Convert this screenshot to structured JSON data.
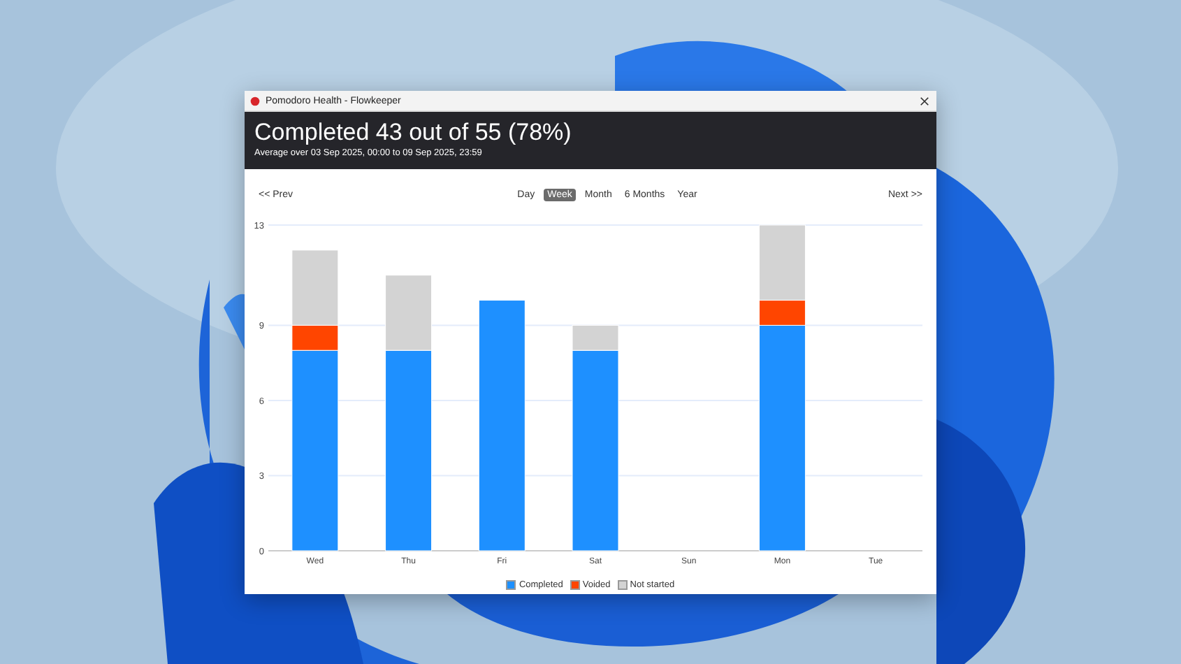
{
  "window": {
    "title": "Pomodoro Health - Flowkeeper"
  },
  "header": {
    "title": "Completed 43 out of 55 (78%)",
    "subtitle": "Average over 03 Sep 2025, 00:00 to 09 Sep 2025, 23:59"
  },
  "nav": {
    "prev": "<< Prev",
    "next": "Next >>",
    "periods": [
      {
        "label": "Day",
        "selected": false
      },
      {
        "label": "Week",
        "selected": true
      },
      {
        "label": "Month",
        "selected": false
      },
      {
        "label": "6 Months",
        "selected": false
      },
      {
        "label": "Year",
        "selected": false
      }
    ]
  },
  "chart_data": {
    "type": "bar",
    "stacked": true,
    "grid": true,
    "categories": [
      "Wed",
      "Thu",
      "Fri",
      "Sat",
      "Sun",
      "Mon",
      "Tue"
    ],
    "ylim": [
      0,
      13
    ],
    "yticks": [
      0,
      3,
      6,
      9,
      13
    ],
    "series": [
      {
        "name": "Completed",
        "color": "#1e90ff",
        "values": [
          8,
          8,
          10,
          8,
          0,
          9,
          0
        ]
      },
      {
        "name": "Voided",
        "color": "#ff4500",
        "values": [
          1,
          0,
          0,
          0,
          0,
          1,
          0
        ]
      },
      {
        "name": "Not started",
        "color": "#d3d3d3",
        "values": [
          3,
          3,
          0,
          1,
          0,
          3,
          0
        ]
      }
    ]
  }
}
